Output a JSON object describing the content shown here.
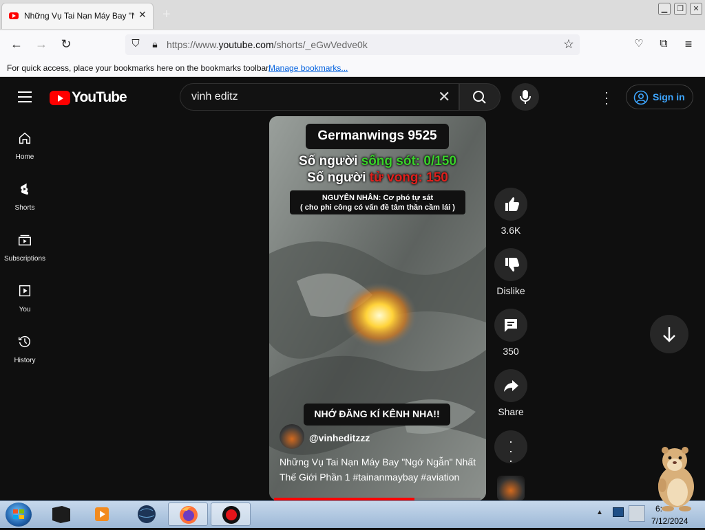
{
  "browser": {
    "tab_title": "Những Vụ Tai Nạn Máy Bay \"Ngớ",
    "url_prefix": "https://www.",
    "url_host": "youtube.com",
    "url_path": "/shorts/_eGwVedve0k",
    "bookmarks_hint": "For quick access, place your bookmarks here on the bookmarks toolbar.",
    "bookmarks_link": "Manage bookmarks..."
  },
  "header": {
    "logo_text": "YouTube",
    "search_value": "vinh editz",
    "signin_label": "Sign in"
  },
  "sidebar": {
    "items": [
      {
        "label": "Home",
        "icon": "home-icon"
      },
      {
        "label": "Shorts",
        "icon": "shorts-icon"
      },
      {
        "label": "Subscriptions",
        "icon": "subscriptions-icon"
      },
      {
        "label": "You",
        "icon": "you-icon"
      },
      {
        "label": "History",
        "icon": "history-icon"
      }
    ]
  },
  "video": {
    "overlay_title": "Germanwings 9525",
    "survivors_label": "Số người ",
    "survivors_key": "sống sót: 0/150",
    "deaths_label": "Số người ",
    "deaths_key": "tử vong: 150",
    "cause_line1": "NGUYÊN NHÂN: Cơ phó tự sát",
    "cause_line2": "( cho phi công có vấn đề tâm thần cầm lái )",
    "subscribe_text": "NHỚ ĐĂNG KÍ KÊNH NHA!!",
    "channel": "@vinheditzzz",
    "description": "Những Vụ Tai Nạn Máy Bay \"Ngớ Ngẫn\" Nhất Thế Giới Phần 1 #tainanmaybay #aviation",
    "progress": 0.68
  },
  "actions": {
    "like_count": "3.6K",
    "dislike_label": "Dislike",
    "comment_count": "350",
    "share_label": "Share"
  },
  "taskbar": {
    "time": "6:",
    "date": "7/12/2024"
  },
  "colors": {
    "accent_red": "#ff0000",
    "link_blue": "#3ea6ff",
    "survive_green": "#39d12a",
    "death_red": "#e0201c"
  }
}
